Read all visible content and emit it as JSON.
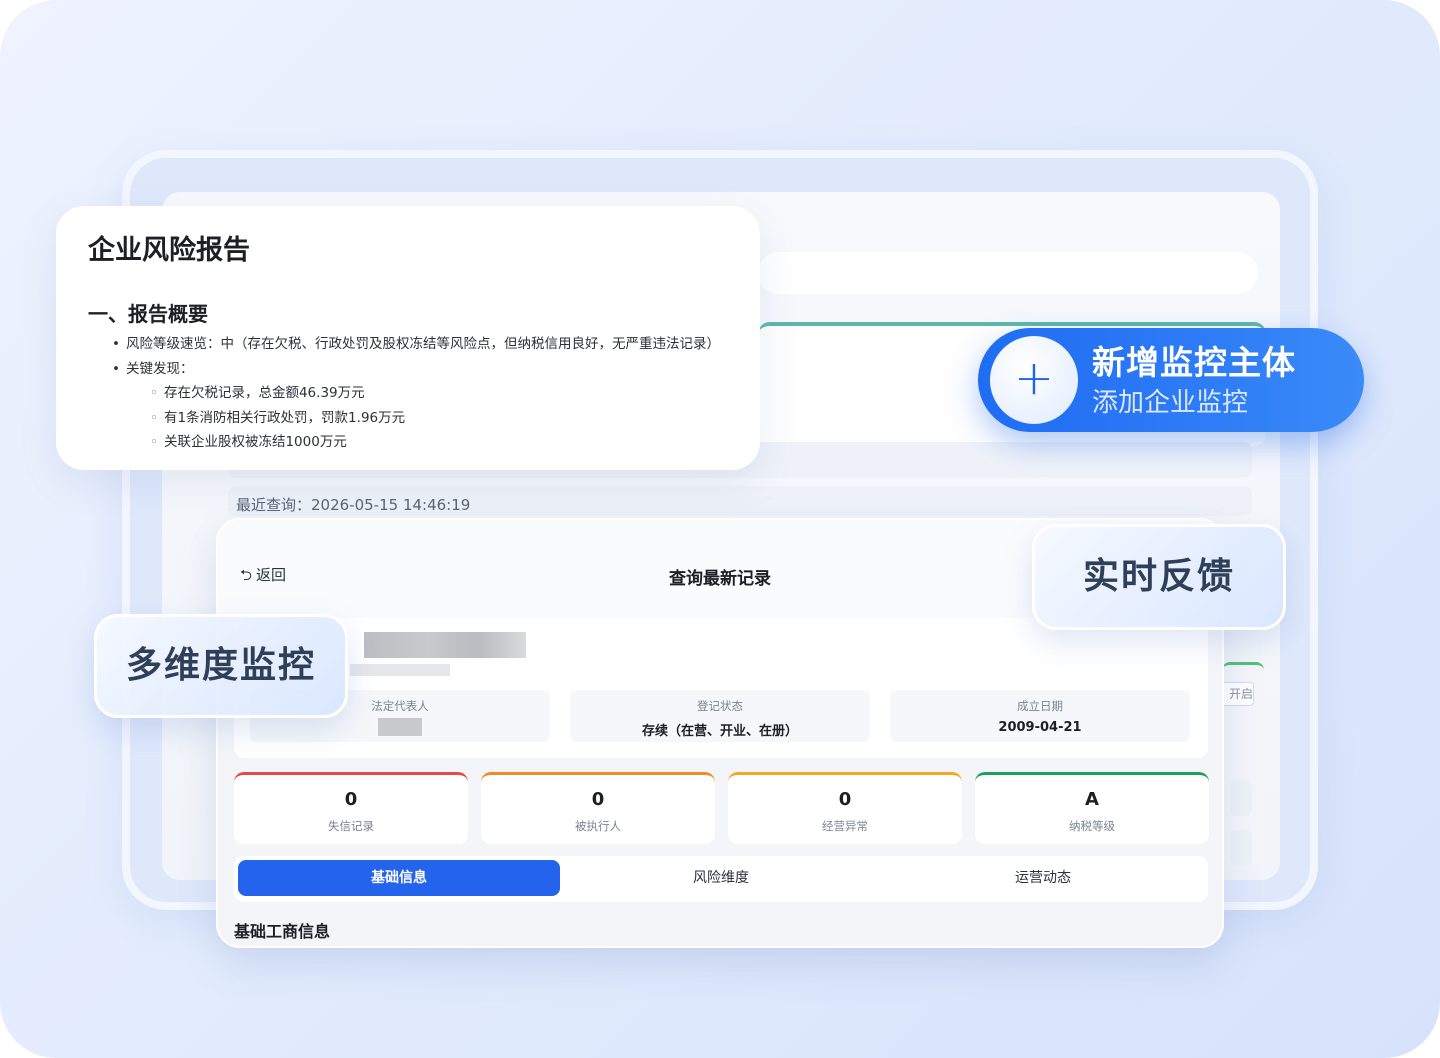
{
  "background": {
    "last_query_label": "最近查询：2026-05-15 14:46:19",
    "side_button_label": "开启"
  },
  "report": {
    "title": "企业风险报告",
    "section1_heading": "一、报告概要",
    "bullet_risk_level": "风险等级速览：中（存在欠税、行政处罚及股权冻结等风险点，但纳税信用良好，无严重违法记录）",
    "bullet_key_findings": "关键发现：",
    "findings": [
      "存在欠税记录，总金额46.39万元",
      "有1条消防相关行政处罚，罚款1.96万元",
      "关联企业股权被冻结1000万元"
    ]
  },
  "add_monitor": {
    "title": "新增监控主体",
    "subtitle": "添加企业监控",
    "icon": "plus-icon"
  },
  "panel": {
    "back_label": "返回",
    "back_icon": "return-arrow-icon",
    "title": "查询最新记录",
    "fields": [
      {
        "label": "法定代表人",
        "value": ""
      },
      {
        "label": "登记状态",
        "value": "存续（在营、开业、在册）"
      },
      {
        "label": "成立日期",
        "value": "2009-04-21"
      }
    ],
    "stats": [
      {
        "value": "0",
        "label": "失信记录",
        "color": "#e8484a"
      },
      {
        "value": "0",
        "label": "被执行人",
        "color": "#f08a24"
      },
      {
        "value": "0",
        "label": "经营异常",
        "color": "#f5a623"
      },
      {
        "value": "A",
        "label": "纳税等级",
        "color": "#1fa05a"
      }
    ],
    "tabs": [
      {
        "label": "基础信息",
        "active": true
      },
      {
        "label": "风险维度",
        "active": false
      },
      {
        "label": "运营动态",
        "active": false
      }
    ],
    "section_title": "基础工商信息"
  },
  "chips": {
    "multi_dimension": "多维度监控",
    "realtime": "实时反馈"
  },
  "colors": {
    "accent": "#2463eb",
    "pill_blue": "#1f6df3"
  }
}
